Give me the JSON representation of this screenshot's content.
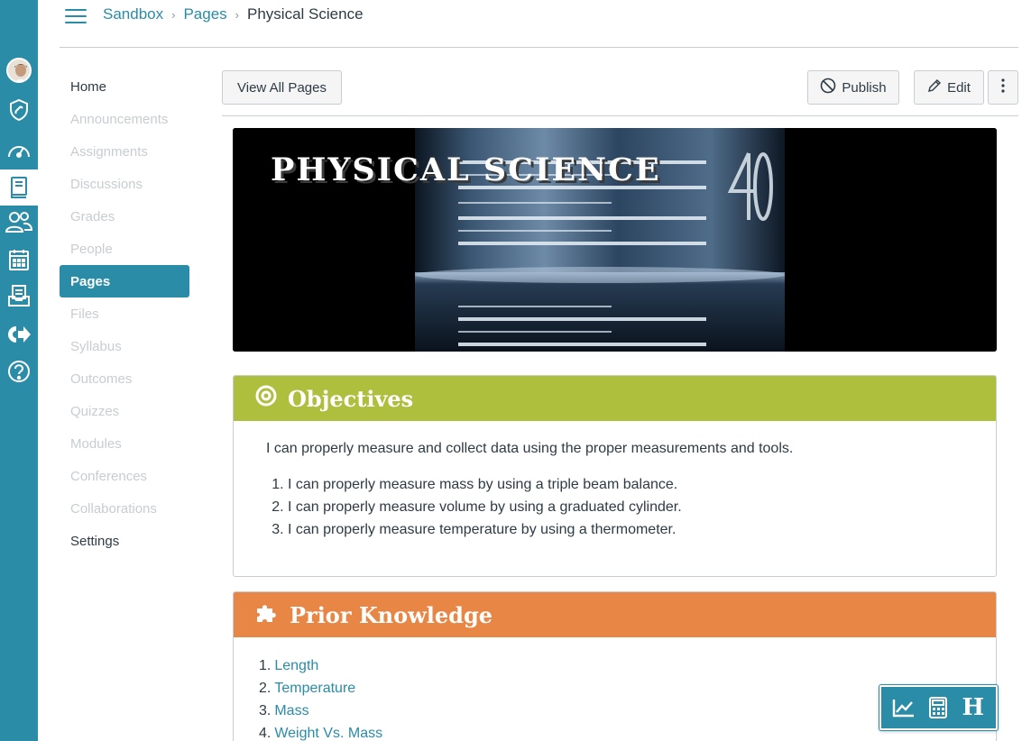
{
  "global_nav": {
    "items": [
      {
        "name": "account",
        "icon": "avatar"
      },
      {
        "name": "admin",
        "icon": "shield-wrench-icon"
      },
      {
        "name": "dashboard",
        "icon": "speedometer-icon"
      },
      {
        "name": "courses",
        "icon": "book-icon"
      },
      {
        "name": "groups",
        "icon": "users-icon"
      },
      {
        "name": "calendar",
        "icon": "calendar-icon"
      },
      {
        "name": "inbox",
        "icon": "inbox-icon"
      },
      {
        "name": "commons",
        "icon": "share-arrow-icon"
      },
      {
        "name": "help",
        "icon": "question-circle-icon"
      }
    ],
    "color": "#2a8ca6"
  },
  "breadcrumb": {
    "items": [
      "Sandbox",
      "Pages",
      "Physical Science"
    ]
  },
  "course_nav": {
    "items": [
      {
        "label": "Home",
        "state": "enabled"
      },
      {
        "label": "Announcements",
        "state": "disabled"
      },
      {
        "label": "Assignments",
        "state": "disabled"
      },
      {
        "label": "Discussions",
        "state": "disabled"
      },
      {
        "label": "Grades",
        "state": "disabled"
      },
      {
        "label": "People",
        "state": "disabled"
      },
      {
        "label": "Pages",
        "state": "active"
      },
      {
        "label": "Files",
        "state": "disabled"
      },
      {
        "label": "Syllabus",
        "state": "disabled"
      },
      {
        "label": "Outcomes",
        "state": "disabled"
      },
      {
        "label": "Quizzes",
        "state": "disabled"
      },
      {
        "label": "Modules",
        "state": "disabled"
      },
      {
        "label": "Conferences",
        "state": "disabled"
      },
      {
        "label": "Collaborations",
        "state": "disabled"
      },
      {
        "label": "Settings",
        "state": "enabled"
      }
    ]
  },
  "toolbar": {
    "view_all_label": "View All Pages",
    "publish_label": "Publish",
    "edit_label": "Edit"
  },
  "banner": {
    "title": "PHYSICAL SCIENCE"
  },
  "objectives": {
    "title": "Objectives",
    "color": "#aebf3e",
    "intro": "I can properly measure and collect data using the proper measurements and tools.",
    "items": [
      "I can properly measure mass by using a triple beam balance.",
      "I can properly measure volume by using a graduated cylinder.",
      "I can properly measure temperature by using a thermometer."
    ]
  },
  "prior_knowledge": {
    "title": "Prior Knowledge",
    "color": "#e88646",
    "items": [
      {
        "num": "1.",
        "label": "Length"
      },
      {
        "num": "2.",
        "label": "Temperature"
      },
      {
        "num": "3.",
        "label": "Mass"
      },
      {
        "num": "4.",
        "label": "Weight Vs. Mass"
      }
    ]
  },
  "floating_tools": {
    "items": [
      "chart-line-icon",
      "calculator-icon",
      "H"
    ],
    "h_label": "H"
  }
}
